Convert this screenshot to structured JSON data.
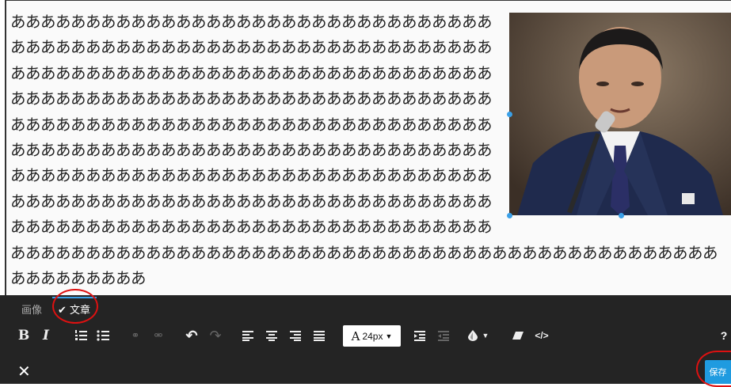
{
  "content": {
    "lines": [
      "ああああああああああああああああああああああああああああああああ",
      "ああああああああああああああああああああああああああああああああ",
      "ああああああああああああああああああああああああああああああああ",
      "ああああああああああああああああああああああああああああああああ",
      "ああああああああああああああああああああああああああああああああ",
      "ああああああああああああああああああああああああああああああああ",
      "ああああああああああああああああああああああああああああああああ",
      "ああああああああああああああああああああああああああああああああ",
      "ああああああああああああああああああああああああああああああああ",
      "あああああああああああああああああああああああああああああああああああああああああああああああ",
      "あああああああああ"
    ],
    "image_alt": "speaker at microphone"
  },
  "tabs": [
    {
      "label": "画像"
    },
    {
      "label": "✔ 文章"
    }
  ],
  "toolbar": {
    "font_size": "24px",
    "font_size_icon": "A",
    "help": "?"
  },
  "footer": {
    "close": "✕",
    "save": "保存"
  },
  "colors": {
    "accent": "#1f9be0",
    "toolbar_bg": "#242424",
    "highlight": "#dd1111"
  }
}
